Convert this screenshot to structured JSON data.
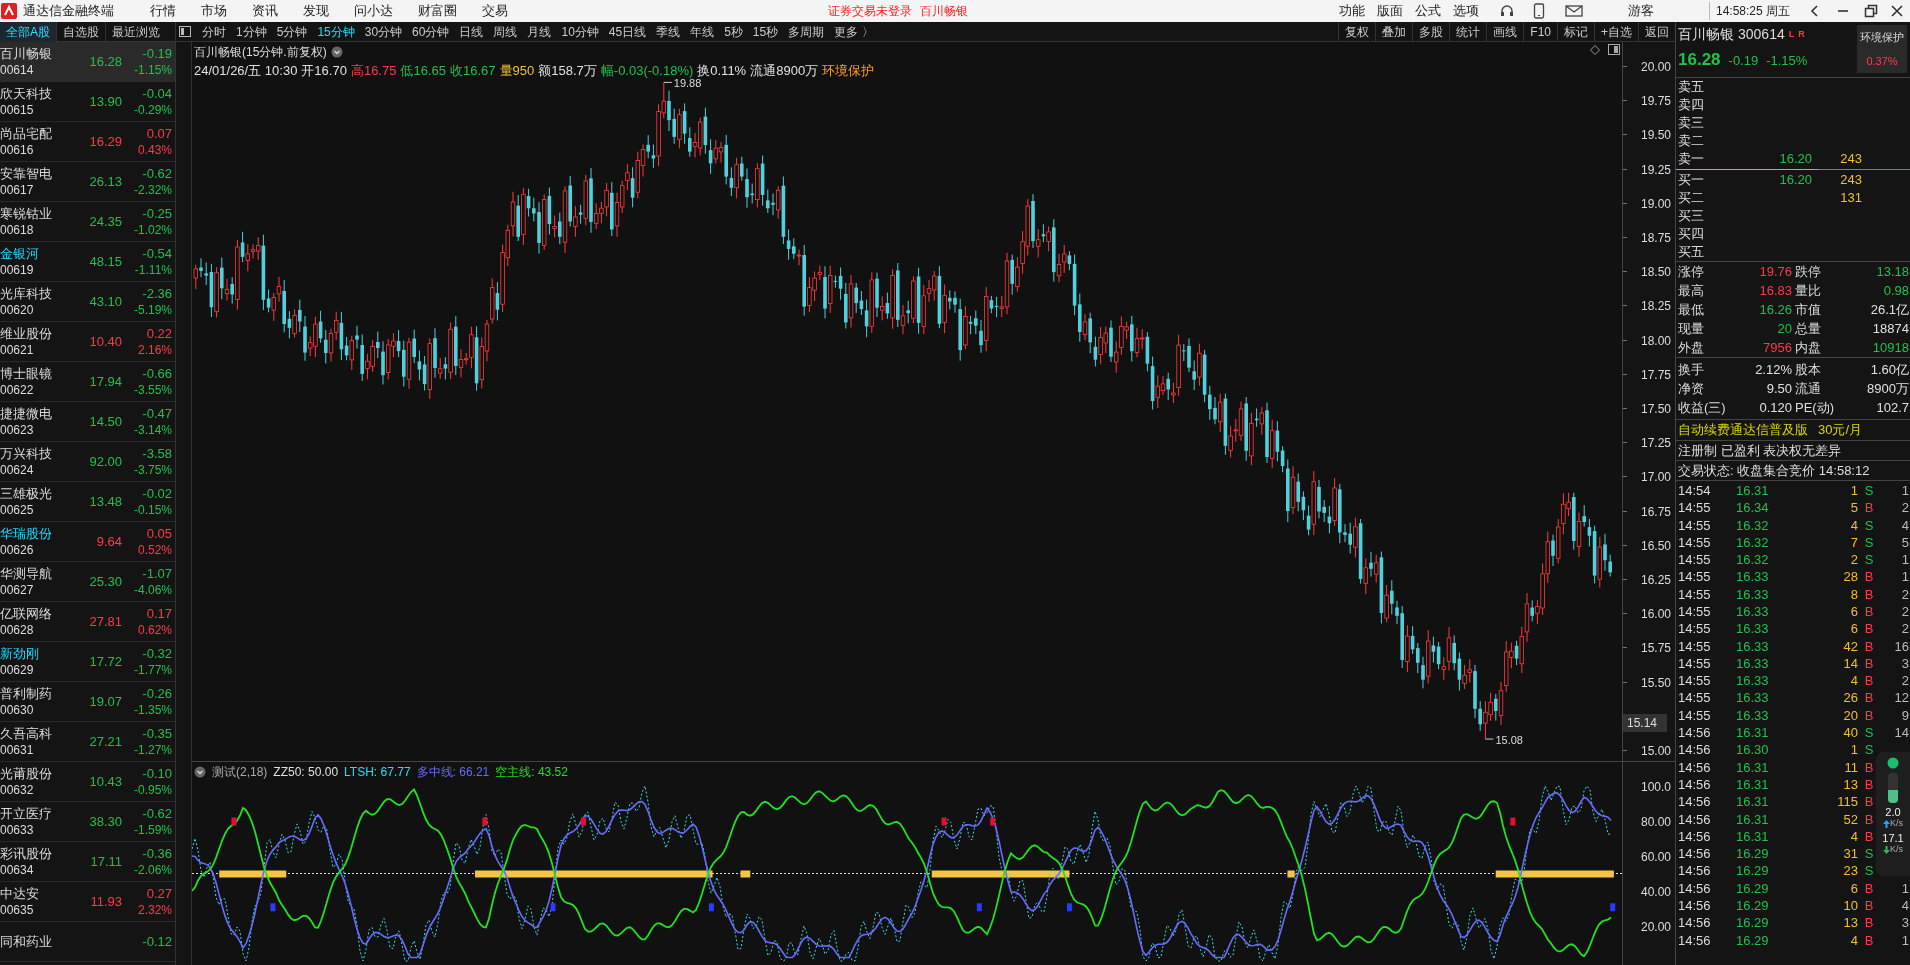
{
  "title_bar": {
    "app_title": "通达信金融终端",
    "menu": [
      "行情",
      "市场",
      "资讯",
      "发现",
      "问小达",
      "财富圈",
      "交易"
    ],
    "login_notice": "证券交易未登录",
    "stock": "百川畅银",
    "right_menu": [
      "功能",
      "版面",
      "公式",
      "选项"
    ],
    "user": "游客",
    "clock": "14:58:25 周五"
  },
  "list_tabs": [
    {
      "label": "全部A股",
      "selected": true
    },
    {
      "label": "自选股",
      "selected": false
    },
    {
      "label": "最近浏览",
      "selected": false
    }
  ],
  "period_tabs": [
    {
      "label": "分时",
      "selected": false
    },
    {
      "label": "1分钟",
      "selected": false
    },
    {
      "label": "5分钟",
      "selected": false
    },
    {
      "label": "15分钟",
      "selected": true
    },
    {
      "label": "30分钟",
      "selected": false
    },
    {
      "label": "60分钟",
      "selected": false
    },
    {
      "label": "日线",
      "selected": false
    },
    {
      "label": "周线",
      "selected": false
    },
    {
      "label": "月线",
      "selected": false
    },
    {
      "label": "10分钟",
      "selected": false
    },
    {
      "label": "45日线",
      "selected": false
    },
    {
      "label": "季线",
      "selected": false
    },
    {
      "label": "年线",
      "selected": false
    },
    {
      "label": "5秒",
      "selected": false
    },
    {
      "label": "15秒",
      "selected": false
    },
    {
      "label": "多周期",
      "selected": false
    },
    {
      "label": "更多 〉",
      "selected": false
    }
  ],
  "tool_buttons": [
    "复权",
    "叠加",
    "多股",
    "统计",
    "画线",
    "F10",
    "标记",
    "+自选",
    "返回"
  ],
  "stock_list": [
    {
      "name": "百川畅银",
      "code": "00614",
      "price": "16.28",
      "change": "-0.19",
      "pct": "-1.15%",
      "rising": false,
      "selected": true,
      "marked": false
    },
    {
      "name": "欣天科技",
      "code": "00615",
      "price": "13.90",
      "change": "-0.04",
      "pct": "-0.29%",
      "rising": false,
      "selected": false,
      "marked": false
    },
    {
      "name": "尚品宅配",
      "code": "00616",
      "price": "16.29",
      "change": "0.07",
      "pct": "0.43%",
      "rising": true,
      "selected": false,
      "marked": false
    },
    {
      "name": "安靠智电",
      "code": "00617",
      "price": "26.13",
      "change": "-0.62",
      "pct": "-2.32%",
      "rising": false,
      "selected": false,
      "marked": false
    },
    {
      "name": "寒锐钴业",
      "code": "00618",
      "price": "24.35",
      "change": "-0.25",
      "pct": "-1.02%",
      "rising": false,
      "selected": false,
      "marked": false
    },
    {
      "name": "金银河",
      "code": "00619",
      "price": "48.15",
      "change": "-0.54",
      "pct": "-1.11%",
      "rising": false,
      "selected": false,
      "marked": true
    },
    {
      "name": "光库科技",
      "code": "00620",
      "price": "43.10",
      "change": "-2.36",
      "pct": "-5.19%",
      "rising": false,
      "selected": false,
      "marked": false
    },
    {
      "name": "维业股份",
      "code": "00621",
      "price": "10.40",
      "change": "0.22",
      "pct": "2.16%",
      "rising": true,
      "selected": false,
      "marked": false
    },
    {
      "name": "博士眼镜",
      "code": "00622",
      "price": "17.94",
      "change": "-0.66",
      "pct": "-3.55%",
      "rising": false,
      "selected": false,
      "marked": false
    },
    {
      "name": "捷捷微电",
      "code": "00623",
      "price": "14.50",
      "change": "-0.47",
      "pct": "-3.14%",
      "rising": false,
      "selected": false,
      "marked": false
    },
    {
      "name": "万兴科技",
      "code": "00624",
      "price": "92.00",
      "change": "-3.58",
      "pct": "-3.75%",
      "rising": false,
      "selected": false,
      "marked": false
    },
    {
      "name": "三雄极光",
      "code": "00625",
      "price": "13.48",
      "change": "-0.02",
      "pct": "-0.15%",
      "rising": false,
      "selected": false,
      "marked": false
    },
    {
      "name": "华瑞股份",
      "code": "00626",
      "price": "9.64",
      "change": "0.05",
      "pct": "0.52%",
      "rising": true,
      "selected": false,
      "marked": true
    },
    {
      "name": "华测导航",
      "code": "00627",
      "price": "25.30",
      "change": "-1.07",
      "pct": "-4.06%",
      "rising": false,
      "selected": false,
      "marked": false
    },
    {
      "name": "亿联网络",
      "code": "00628",
      "price": "27.81",
      "change": "0.17",
      "pct": "0.62%",
      "rising": true,
      "selected": false,
      "marked": false
    },
    {
      "name": "新劲刚",
      "code": "00629",
      "price": "17.72",
      "change": "-0.32",
      "pct": "-1.77%",
      "rising": false,
      "selected": false,
      "marked": true
    },
    {
      "name": "普利制药",
      "code": "00630",
      "price": "19.07",
      "change": "-0.26",
      "pct": "-1.35%",
      "rising": false,
      "selected": false,
      "marked": false
    },
    {
      "name": "久吾高科",
      "code": "00631",
      "price": "27.21",
      "change": "-0.35",
      "pct": "-1.27%",
      "rising": false,
      "selected": false,
      "marked": false
    },
    {
      "name": "光莆股份",
      "code": "00632",
      "price": "10.43",
      "change": "-0.10",
      "pct": "-0.95%",
      "rising": false,
      "selected": false,
      "marked": false
    },
    {
      "name": "开立医疗",
      "code": "00633",
      "price": "38.30",
      "change": "-0.62",
      "pct": "-1.59%",
      "rising": false,
      "selected": false,
      "marked": false
    },
    {
      "name": "彩讯股份",
      "code": "00634",
      "price": "17.11",
      "change": "-0.36",
      "pct": "-2.06%",
      "rising": false,
      "selected": false,
      "marked": false
    },
    {
      "name": "中达安",
      "code": "00635",
      "price": "11.93",
      "change": "0.27",
      "pct": "2.32%",
      "rising": true,
      "selected": false,
      "marked": false
    },
    {
      "name": "同和药业",
      "change": "-0.12",
      "rising": false,
      "selected": false,
      "marked": false
    }
  ],
  "chart": {
    "title": "百川畅银(15分钟.前复权)",
    "info": [
      {
        "text": "24/01/26/五 10:30",
        "color": "#e0e0e0"
      },
      {
        "text": "开16.70",
        "color": "#e0e0e0"
      },
      {
        "text": "高16.75",
        "color": "#ff3b4a"
      },
      {
        "text": "低16.65",
        "color": "#22c04d"
      },
      {
        "text": "收16.67",
        "color": "#22c04d"
      },
      {
        "text": "量950",
        "color": "#f0c030"
      },
      {
        "text": "额158.7万",
        "color": "#e0e0e0"
      },
      {
        "text": "幅-0.03(-0.18%)",
        "color": "#22c04d"
      },
      {
        "text": "换0.11%",
        "color": "#e0e0e0"
      },
      {
        "text": "流通8900万",
        "color": "#e0e0e0"
      },
      {
        "text": "环境保护",
        "color": "#ffa020"
      }
    ],
    "price_axis": [
      "20.00",
      "19.75",
      "19.50",
      "19.25",
      "19.00",
      "18.75",
      "18.50",
      "18.25",
      "18.00",
      "17.75",
      "17.50",
      "17.25",
      "17.00",
      "16.75",
      "16.50",
      "16.25",
      "16.00",
      "15.75",
      "15.50",
      "15.00"
    ],
    "price_tag": "15.14",
    "high_label": "19.88",
    "low_label": "15.08"
  },
  "indicator": {
    "name": "测试(2,18)",
    "values": [
      {
        "text": "ZZ50: 50.00",
        "color": "#e0e0e0"
      },
      {
        "text": "LTSH: 67.77",
        "color": "#20e0ff"
      },
      {
        "text": "多中线: 66.21",
        "color": "#6a6aff"
      },
      {
        "text": "空主线: 43.52",
        "color": "#22e022"
      }
    ],
    "axis": [
      "100.0",
      "80.00",
      "60.00",
      "40.00",
      "20.00"
    ]
  },
  "quote": {
    "name": "百川畅银",
    "code": "300614",
    "marks": [
      "L",
      "R"
    ],
    "price": "16.28",
    "change": "-0.19",
    "pct": "-1.15%",
    "badge": {
      "label": "环境保护",
      "value": "0.37%"
    },
    "asks": [
      {
        "label": "卖五"
      },
      {
        "label": "卖四"
      },
      {
        "label": "卖三"
      },
      {
        "label": "卖二"
      },
      {
        "label": "卖一",
        "price": "16.20",
        "volume": "243"
      }
    ],
    "bids": [
      {
        "label": "买一",
        "price": "16.20",
        "volume": "243"
      },
      {
        "label": "买二",
        "volume": "131"
      },
      {
        "label": "买三"
      },
      {
        "label": "买四"
      },
      {
        "label": "买五"
      }
    ],
    "stats": [
      {
        "label": "涨停",
        "value": "19.76",
        "color": "#ff3b4a"
      },
      {
        "label": "跌停",
        "value": "13.18",
        "color": "#22c04d"
      },
      {
        "label": "最高",
        "value": "16.83",
        "color": "#ff3b4a"
      },
      {
        "label": "量比",
        "value": "0.98",
        "color": "#22c04d"
      },
      {
        "label": "最低",
        "value": "16.26",
        "color": "#22c04d"
      },
      {
        "label": "市值",
        "value": "26.1亿",
        "color": "#e0e0e0"
      },
      {
        "label": "现量",
        "value": "20",
        "color": "#22c04d"
      },
      {
        "label": "总量",
        "value": "18874",
        "color": "#e0e0e0"
      },
      {
        "label": "外盘",
        "value": "7956",
        "color": "#ff3b4a"
      },
      {
        "label": "内盘",
        "value": "10918",
        "color": "#22c04d"
      }
    ],
    "stats2": [
      {
        "label": "换手",
        "value": "2.12%",
        "color": "#e0e0e0"
      },
      {
        "label": "股本",
        "value": "1.60亿",
        "color": "#e0e0e0"
      },
      {
        "label": "净资",
        "value": "9.50",
        "color": "#e0e0e0"
      },
      {
        "label": "流通",
        "value": "8900万",
        "color": "#e0e0e0"
      },
      {
        "label": "收益(三)",
        "value": "0.120",
        "color": "#e0e0e0"
      },
      {
        "label": "PE(动)",
        "value": "102.7",
        "color": "#e0e0e0"
      }
    ],
    "notice": {
      "text": "自动续费通达信普及版",
      "price": "30元/月"
    },
    "tags": "注册制 已盈利 表决权无差异",
    "status": "交易状态: 收盘集合竞价 14:58:12"
  },
  "trades": [
    {
      "time": "14:54",
      "price": "16.31",
      "volume": "1",
      "side": "S",
      "count": "1"
    },
    {
      "time": "14:55",
      "price": "16.34",
      "volume": "5",
      "side": "B",
      "count": "2"
    },
    {
      "time": "14:55",
      "price": "16.32",
      "volume": "4",
      "side": "S",
      "count": "4"
    },
    {
      "time": "14:55",
      "price": "16.32",
      "volume": "7",
      "side": "S",
      "count": "5"
    },
    {
      "time": "14:55",
      "price": "16.32",
      "volume": "2",
      "side": "S",
      "count": "1"
    },
    {
      "time": "14:55",
      "price": "16.33",
      "volume": "28",
      "side": "B",
      "count": "1"
    },
    {
      "time": "14:55",
      "price": "16.33",
      "volume": "8",
      "side": "B",
      "count": "2"
    },
    {
      "time": "14:55",
      "price": "16.33",
      "volume": "6",
      "side": "B",
      "count": "2"
    },
    {
      "time": "14:55",
      "price": "16.33",
      "volume": "6",
      "side": "B",
      "count": "2"
    },
    {
      "time": "14:55",
      "price": "16.33",
      "volume": "42",
      "side": "B",
      "count": "16"
    },
    {
      "time": "14:55",
      "price": "16.33",
      "volume": "14",
      "side": "B",
      "count": "3"
    },
    {
      "time": "14:55",
      "price": "16.33",
      "volume": "4",
      "side": "B",
      "count": "2"
    },
    {
      "time": "14:55",
      "price": "16.33",
      "volume": "26",
      "side": "B",
      "count": "12"
    },
    {
      "time": "14:55",
      "price": "16.33",
      "volume": "20",
      "side": "B",
      "count": "9"
    },
    {
      "time": "14:56",
      "price": "16.31",
      "volume": "40",
      "side": "S",
      "count": "14"
    },
    {
      "time": "14:56",
      "price": "16.30",
      "volume": "1",
      "side": "S"
    },
    {
      "time": "14:56",
      "price": "16.31",
      "volume": "11",
      "side": "B"
    },
    {
      "time": "14:56",
      "price": "16.31",
      "volume": "13",
      "side": "B"
    },
    {
      "time": "14:56",
      "price": "16.31",
      "volume": "115",
      "side": "B"
    },
    {
      "time": "14:56",
      "price": "16.31",
      "volume": "52",
      "side": "B"
    },
    {
      "time": "14:56",
      "price": "16.31",
      "volume": "4",
      "side": "B"
    },
    {
      "time": "14:56",
      "price": "16.29",
      "volume": "31",
      "side": "S"
    },
    {
      "time": "14:56",
      "price": "16.29",
      "volume": "23",
      "side": "S"
    },
    {
      "time": "14:56",
      "price": "16.29",
      "volume": "6",
      "side": "B",
      "count": "1"
    },
    {
      "time": "14:56",
      "price": "16.29",
      "volume": "10",
      "side": "B",
      "count": "4"
    },
    {
      "time": "14:56",
      "price": "16.29",
      "volume": "13",
      "side": "B",
      "count": "3"
    },
    {
      "time": "14:56",
      "price": "16.29",
      "volume": "4",
      "side": "B",
      "count": "1"
    }
  ],
  "net_widget": {
    "level": 0.45,
    "up": {
      "value": "2.0",
      "unit": "K/s"
    },
    "down": {
      "value": "17.1",
      "unit": "K/s"
    }
  }
}
